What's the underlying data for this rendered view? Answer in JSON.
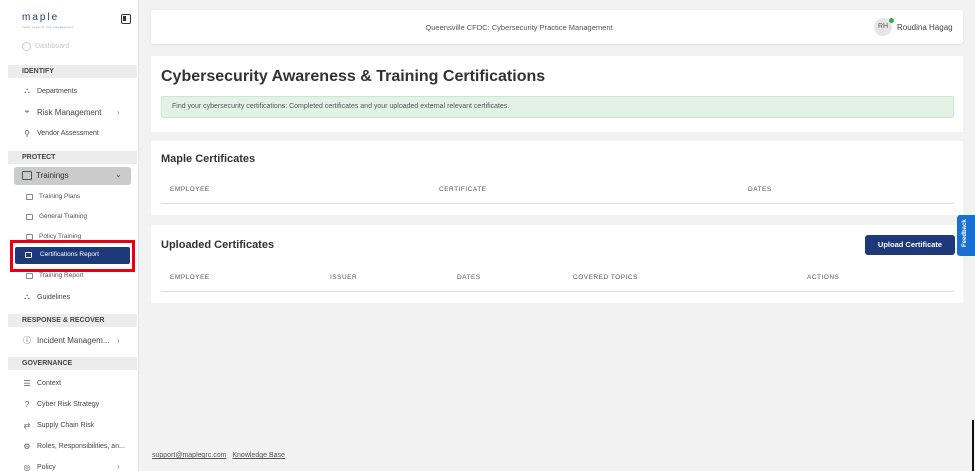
{
  "brand": {
    "name": "maple",
    "tagline": "cyber security risk management"
  },
  "sidebar": {
    "dashboard": "Dashboard",
    "sections": {
      "identify": "IDENTIFY",
      "protect": "PROTECT",
      "response": "RESPONSE & RECOVER",
      "governance": "GOVERNANCE"
    },
    "items": {
      "departments": "Departments",
      "risk_management": "Risk Management",
      "vendor_assessment": "Vendor Assessment",
      "trainings": "Trainings",
      "training_plans": "Training Plans",
      "general_training": "General Training",
      "policy_training": "Policy Training",
      "certifications_report": "Certifications Report",
      "training_report": "Training Report",
      "guidelines": "Guidelines",
      "incident_management": "Incident Managem...",
      "context": "Context",
      "cyber_risk_strategy": "Cyber Risk Strategy",
      "supply_chain_risk": "Supply Chain Risk",
      "roles": "Roles, Responsibilities, an...",
      "policy": "Policy"
    }
  },
  "header": {
    "title": "Queensville CFDC: Cybersecurity Practice Management",
    "user_initials": "RH",
    "user_name": "Roudina Hagag"
  },
  "page": {
    "title": "Cybersecurity Awareness & Training Certifications",
    "info": "Find your cybersecurity certifications: Completed certificates and your uploaded external relevant certificates."
  },
  "maple_certificates": {
    "title": "Maple Certificates",
    "columns": [
      "EMPLOYEE",
      "CERTIFICATE",
      "DATES"
    ]
  },
  "uploaded_certificates": {
    "title": "Uploaded Certificates",
    "upload_label": "Upload Certificate",
    "columns": [
      "EMPLOYEE",
      "ISSUER",
      "DATES",
      "COVERED TOPICS",
      "ACTIONS"
    ]
  },
  "footer": {
    "support": "support@maplegrc.com",
    "kb": "Knowledge Base"
  },
  "feedback_label": "Feedback",
  "colors": {
    "accent": "#1d3979",
    "highlight": "#e60012",
    "info_bg": "#e2f3e6",
    "feedback": "#1a6fd3"
  }
}
